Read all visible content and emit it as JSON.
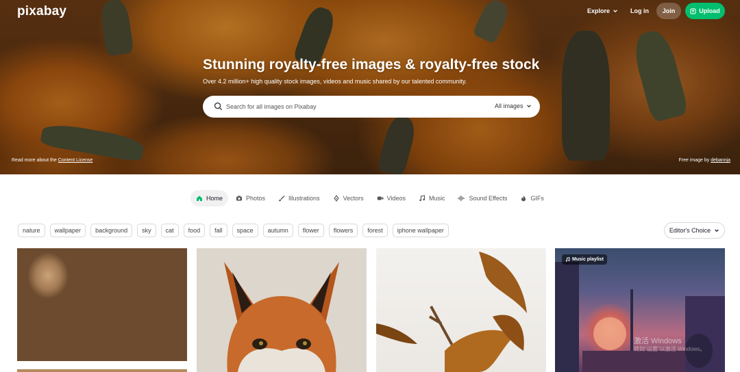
{
  "header": {
    "logo": "pixabay",
    "nav": {
      "explore": "Explore",
      "login": "Log in",
      "join": "Join",
      "upload": "Upload"
    }
  },
  "hero": {
    "title": "Stunning royalty-free images & royalty-free stock",
    "subtitle": "Over 4.2 million+ high quality stock images, videos and music shared by our talented community.",
    "search": {
      "placeholder": "Search for all images on Pixabay",
      "type": "All images"
    },
    "license_prefix": "Read more about the",
    "license_link": "Content License",
    "credit_prefix": "Free image by",
    "credit_user": "debannja"
  },
  "tabs": [
    {
      "label": "Home",
      "icon": "home-icon",
      "active": true
    },
    {
      "label": "Photos",
      "icon": "camera-icon"
    },
    {
      "label": "Illustrations",
      "icon": "brush-icon"
    },
    {
      "label": "Vectors",
      "icon": "pen-icon"
    },
    {
      "label": "Videos",
      "icon": "video-icon"
    },
    {
      "label": "Music",
      "icon": "music-icon"
    },
    {
      "label": "Sound Effects",
      "icon": "waveform-icon"
    },
    {
      "label": "GIFs",
      "icon": "gif-icon"
    }
  ],
  "tags": [
    "nature",
    "wallpaper",
    "background",
    "sky",
    "cat",
    "food",
    "fall",
    "space",
    "autumn",
    "flower",
    "flowers",
    "forest",
    "iphone wallpaper"
  ],
  "sort": "Editor's Choice",
  "grid": {
    "music_badge": "Music playlist",
    "watermark_line1": "激活 Windows",
    "watermark_line2": "转到\"设置\"以激活 Windows。"
  },
  "colors": {
    "accent": "#02be6e",
    "text": "#191b26"
  }
}
